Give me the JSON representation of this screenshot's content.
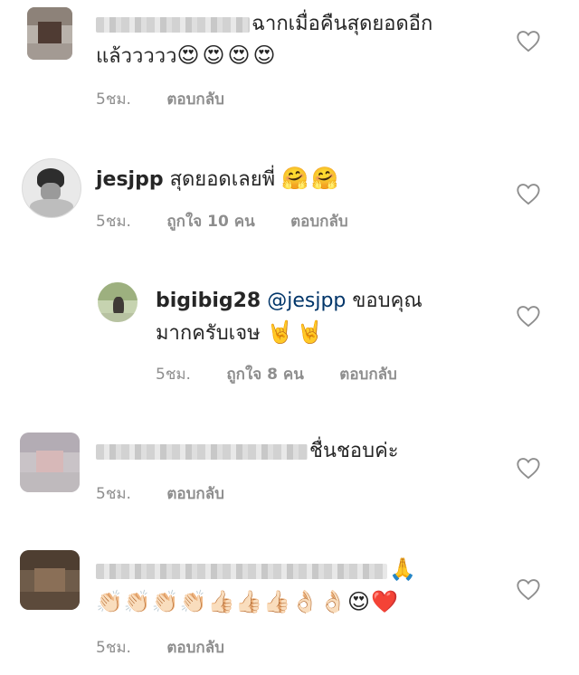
{
  "comments": [
    {
      "text": "ฉากเมื่อคืนสุดยอดอีก",
      "text2": "แล้ววววว",
      "emoji": "😍😍😍😍",
      "time": "5ชม.",
      "reply": "ตอบกลับ"
    },
    {
      "username": "jesjpp",
      "text": " สุดยอดเลยพี่ ",
      "emoji": "🤗🤗",
      "time": "5ชม.",
      "likes": "ถูกใจ 10 คน",
      "reply": "ตอบกลับ"
    },
    {
      "username": "bigibig28",
      "mention": "@jesjpp",
      "text": " ขอบคุณ",
      "text2": "มากครับเจษ ",
      "emoji": "🤘🤘",
      "time": "5ชม.",
      "likes": "ถูกใจ 8 คน",
      "reply": "ตอบกลับ"
    },
    {
      "text": "ชื่นชอบค่ะ",
      "time": "5ชม.",
      "reply": "ตอบกลับ"
    },
    {
      "emoji": "🙏",
      "emoji2": "👏🏻👏🏻👏🏻👏🏻👍🏻👍🏻👍🏻👌🏻👌🏻😍❤️",
      "time": "5ชม.",
      "reply": "ตอบกลับ"
    }
  ],
  "icons": {
    "like": "heart-outline-icon"
  },
  "colors": {
    "meta": "#8e8e8e",
    "mention": "#003569",
    "text": "#262626"
  }
}
